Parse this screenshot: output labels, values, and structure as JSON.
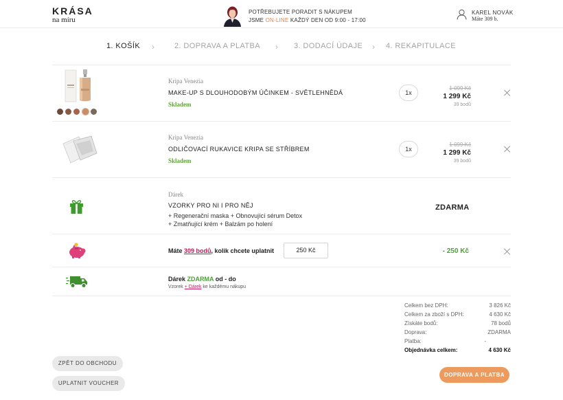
{
  "header": {
    "logo_main": "KRÁSA",
    "logo_sub": "na míru",
    "help_line1": "POTŘEBUJETE PORADIT S NÁKUPEM",
    "help_line2_prefix": "JSME ",
    "help_line2_online": "ON-LINE",
    "help_line2_suffix": " KAŽDÝ DEN OD 9:00 - 17:00",
    "user_name": "KAREL NOVÁK",
    "user_points": "Máte 309 b."
  },
  "steps": [
    {
      "label": "1. KOŠÍK",
      "active": true
    },
    {
      "label": "2. DOPRAVA A PLATBA",
      "active": false
    },
    {
      "label": "3. DODACÍ ÚDAJE",
      "active": false
    },
    {
      "label": "4. REKAPITULACE",
      "active": false
    }
  ],
  "cart": [
    {
      "brand": "Kripa Venezia",
      "name": "MAKE-UP S DLOUHODOBÝM ÚČINKEM - SVĚTLEHNĚDÁ",
      "stock": "Skladem",
      "qty": "1x",
      "price_old": "1 099 Kč",
      "price_new": "1 299 Kč",
      "points": "39 bodů"
    },
    {
      "brand": "Kripa Venezia",
      "name": "ODLIČOVACÍ RUKAVICE KRIPA SE STŘÍBREM",
      "stock": "Skladem",
      "qty": "1x",
      "price_old": "1 099 Kč",
      "price_new": "1 299 Kč",
      "points": "39 bodů"
    }
  ],
  "gift": {
    "label": "Dárek",
    "name": "VZORKY PRO NI I PRO NĚJ",
    "line1": "+ Regenerační maska + Obnovující sérum Detox",
    "line2": "+ Zmatňující krém + Balzám po holení",
    "price": "ZDARMA"
  },
  "points_row": {
    "prefix": "Máte ",
    "link": "309 bodů",
    "suffix": ", kolik chcete uplatnit",
    "input_value": "250 Kč",
    "discount": "- 250 Kč"
  },
  "gift_free": {
    "title_prefix": "Dárek ",
    "title_green": "ZDARMA",
    "title_suffix": " od - do",
    "sub_prefix": "Vzorek ",
    "sub_link": "+ Dárek",
    "sub_suffix": " ke každému nákupu"
  },
  "summary": [
    {
      "label": "Celkem bez DPH:",
      "value": "3 826 Kč"
    },
    {
      "label": "Celkem za zboží s DPH:",
      "value": "4 630 Kč"
    },
    {
      "label": "Získáte bodů:",
      "value": "78 bodů"
    },
    {
      "label": "Doprava:",
      "value": "ZDARMA"
    },
    {
      "label": "Platba:",
      "value": "-"
    },
    {
      "label": "Objednávka celkem:",
      "value": "4 630 Kč"
    }
  ],
  "buttons": {
    "back": "ZPĚT DO OBCHODU",
    "voucher": "UPLATNIT VOUCHER",
    "next": "DOPRAVA A PLATBA"
  },
  "colors": {
    "accent_orange": "#ec9a5e",
    "online_orange": "#e9843f",
    "stock_green": "#5fa536",
    "discount_green": "#4c9f38",
    "link_pink": "#c2185b",
    "gift_icon_green": "#3f9a2f",
    "piggy_pink": "#e0407a",
    "truck_green": "#3f8f2f"
  },
  "swatch_colors": [
    "#6b4a3a",
    "#8a5a44",
    "#a8644a",
    "#c98d6a",
    "#7a6a5e"
  ]
}
